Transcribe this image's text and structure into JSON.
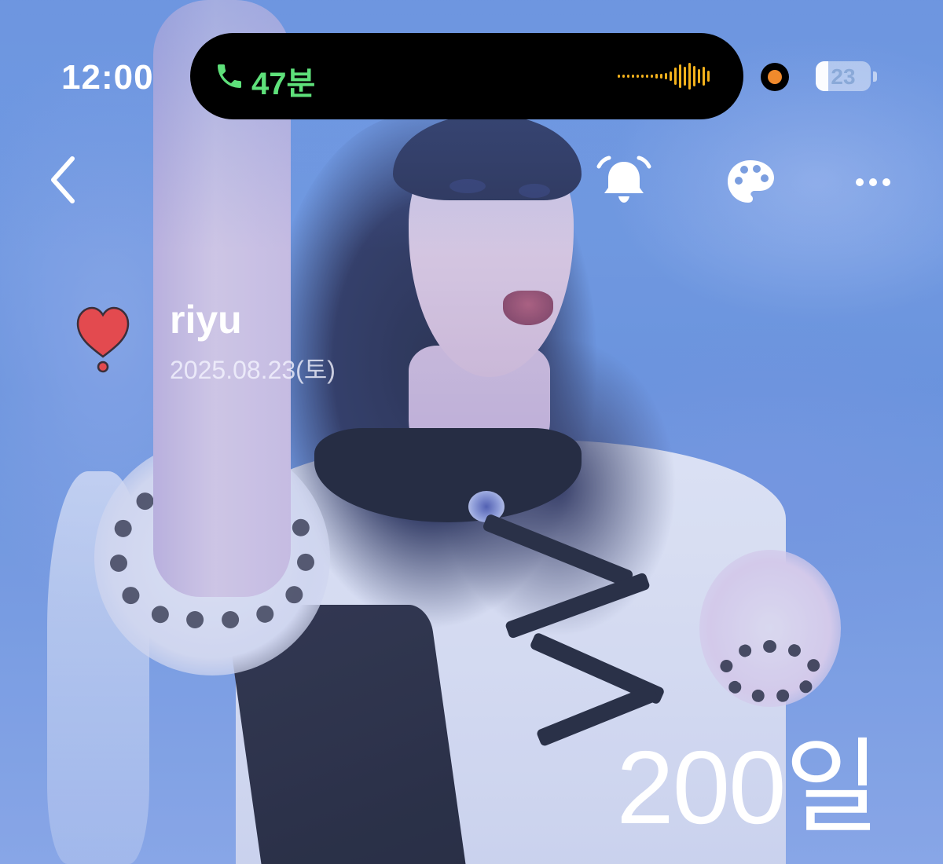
{
  "status_bar": {
    "time": "12:00",
    "call_duration": "47분",
    "battery_level": "23",
    "battery_fraction": 0.23,
    "recording_indicator_color": "#f08a2c",
    "call_text_color": "#5ee07a"
  },
  "nav": {
    "back_icon": "chevron-left-icon",
    "alarm_icon": "bell-icon",
    "theme_icon": "palette-icon",
    "more_icon": "ellipsis-icon"
  },
  "profile": {
    "icon": "heart-exclamation-icon",
    "name": "riyu",
    "date": "2025.08.23(토)"
  },
  "counter": {
    "dday": "200일"
  },
  "colors": {
    "heart": "#e34a4f",
    "background_tint": "#6f95d9"
  }
}
